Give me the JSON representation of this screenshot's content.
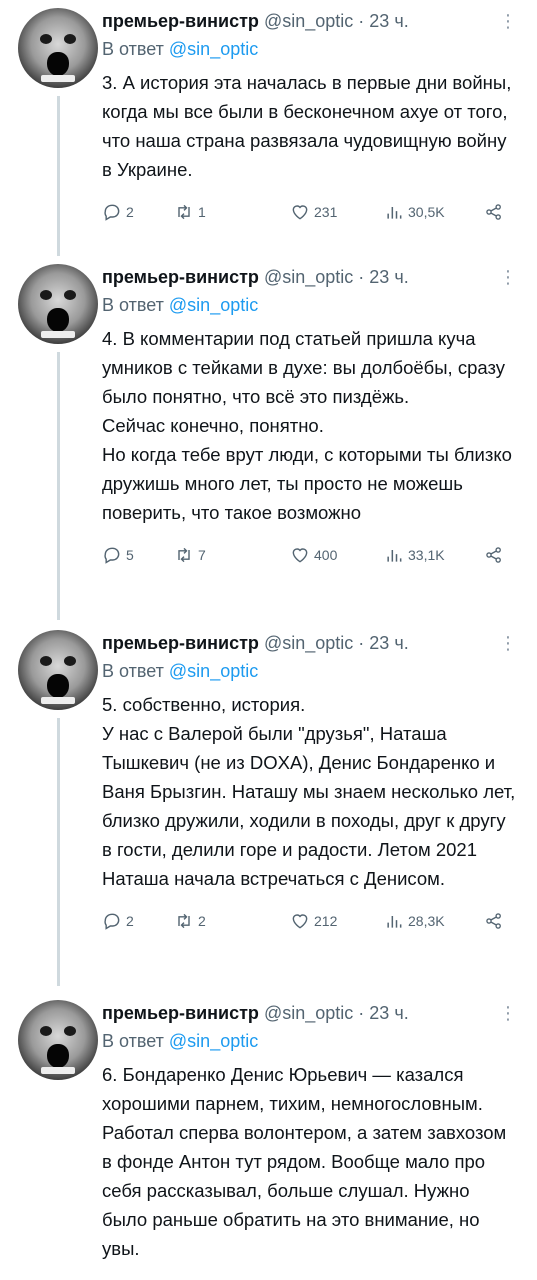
{
  "tweets": [
    {
      "author": "премьер-винистр",
      "handle": "@sin_optic",
      "sep": "·",
      "time": "23 ч.",
      "reply_prefix": "В ответ",
      "reply_to": "@sin_optic",
      "lines": [
        "3. А история эта началась в первые дни войны, когда мы все были в бесконечном ахуе от того, что наша страна развязала чудовищную войну в Украине."
      ],
      "replies": "2",
      "retweets": "1",
      "likes": "231",
      "views": "30,5K"
    },
    {
      "author": "премьер-винистр",
      "handle": "@sin_optic",
      "sep": "·",
      "time": "23 ч.",
      "reply_prefix": "В ответ",
      "reply_to": "@sin_optic",
      "lines": [
        "4. В комментарии под статьей пришла куча умников с тейками в духе: вы долбоёбы, сразу было понятно, что всё это пиздёжь.",
        "Сейчас конечно, понятно.",
        "Но когда тебе врут люди, с которыми ты близко дружишь много лет, ты просто не можешь поверить, что такое возможно"
      ],
      "replies": "5",
      "retweets": "7",
      "likes": "400",
      "views": "33,1K"
    },
    {
      "author": "премьер-винистр",
      "handle": "@sin_optic",
      "sep": "·",
      "time": "23 ч.",
      "reply_prefix": "В ответ",
      "reply_to": "@sin_optic",
      "lines": [
        "5. собственно, история.",
        "У нас с Валерой были \"друзья\", Наташа Тышкевич (не из DOXA),  Денис Бондаренко и Ваня Брызгин. Наташу мы знаем несколько лет, близко дружили, ходили в походы, друг к другу в гости, делили горе и радости. Летом 2021 Наташа начала встречаться с Денисом."
      ],
      "replies": "2",
      "retweets": "2",
      "likes": "212",
      "views": "28,3K"
    },
    {
      "author": "премьер-винистр",
      "handle": "@sin_optic",
      "sep": "·",
      "time": "23 ч.",
      "reply_prefix": "В ответ",
      "reply_to": "@sin_optic",
      "lines": [
        "6. Бондаренко Денис Юрьевич — казался хорошими парнем, тихим, немногословным. Работал сперва волонтером, а затем завхозом в фонде Антон тут рядом. Вообще мало про себя рассказывал, больше слушал. Нужно было раньше обратить на это внимание, но увы."
      ]
    }
  ],
  "icons": {
    "reply": "speech-bubble-icon",
    "retweet": "retweet-icon",
    "like": "heart-icon",
    "views": "bar-chart-icon",
    "share": "share-icon",
    "more": "more-dots-icon"
  },
  "colors": {
    "text": "#0f1419",
    "secondary": "#536471",
    "link": "#1d9bf0",
    "thread_line": "#cfd9de"
  }
}
